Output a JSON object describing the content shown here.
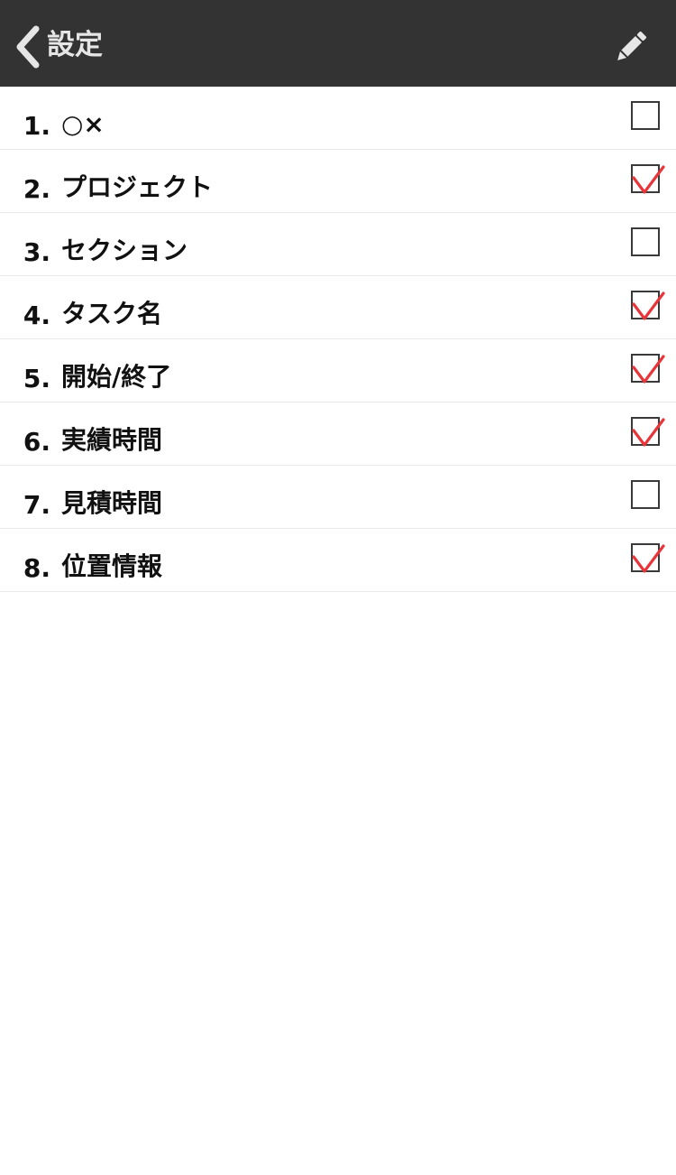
{
  "header": {
    "title": "設定",
    "back_icon": "chevron-left-icon",
    "edit_icon": "pencil-icon",
    "background_color": "#333333",
    "text_color": "#e6e6e6"
  },
  "check_color": "#e8353a",
  "items": [
    {
      "number": "1.",
      "label": "○×",
      "checked": false
    },
    {
      "number": "2.",
      "label": "プロジェクト",
      "checked": true
    },
    {
      "number": "3.",
      "label": "セクション",
      "checked": false
    },
    {
      "number": "4.",
      "label": "タスク名",
      "checked": true
    },
    {
      "number": "5.",
      "label": "開始/終了",
      "checked": true
    },
    {
      "number": "6.",
      "label": "実績時間",
      "checked": true
    },
    {
      "number": "7.",
      "label": "見積時間",
      "checked": false
    },
    {
      "number": "8.",
      "label": "位置情報",
      "checked": true
    }
  ]
}
